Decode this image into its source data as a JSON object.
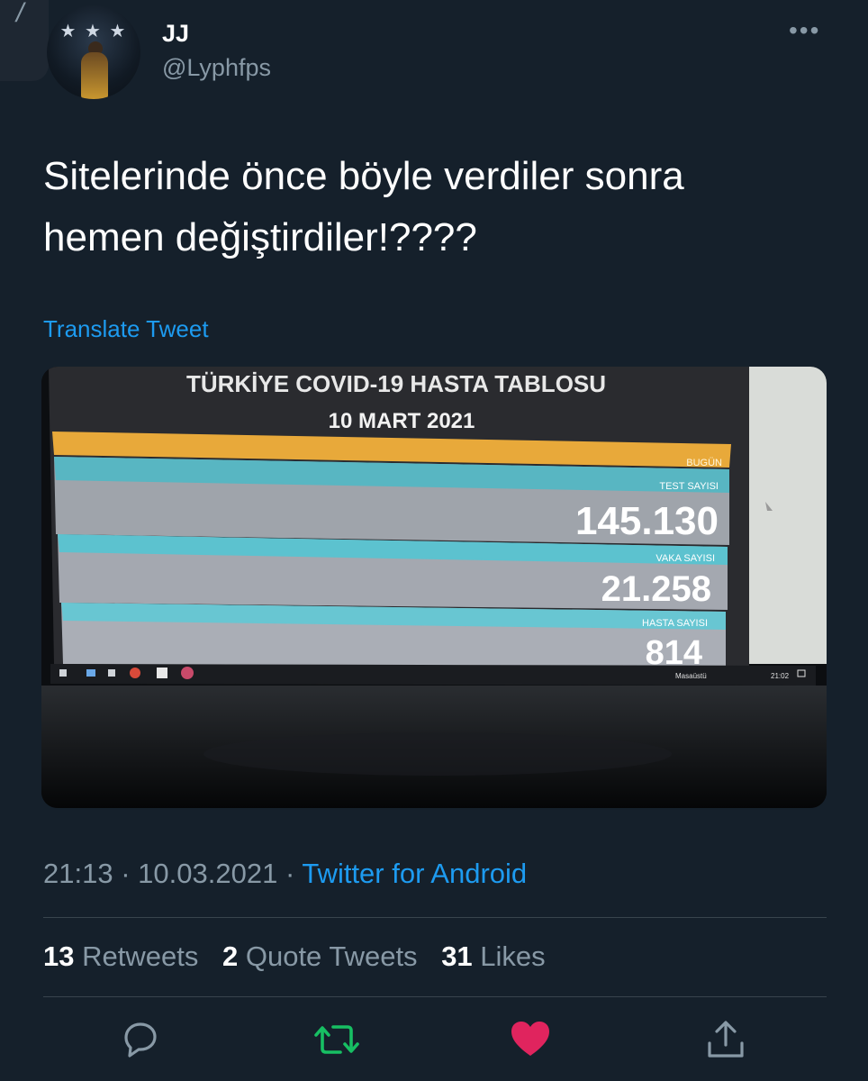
{
  "tweet": {
    "author_name": "JJ",
    "author_handle": "@Lyphfps",
    "text_line1": "Sitelerinde önce böyle verdiler sonra",
    "text_line2": "hemen değiştirdiler!????",
    "translate_label": "Translate Tweet",
    "time": "21:13",
    "separator": "·",
    "date": "10.03.2021",
    "source": "Twitter for Android"
  },
  "media": {
    "title": "TÜRKİYE COVID-19 HASTA TABLOSU",
    "date": "10 MART 2021",
    "header_label": "BUGÜN",
    "rows": [
      {
        "label": "TEST SAYISI",
        "value": "145.130"
      },
      {
        "label": "VAKA SAYISI",
        "value": "21.258"
      },
      {
        "label": "HASTA SAYISI",
        "value": "814"
      }
    ],
    "taskbar_text": "Masaüstü",
    "taskbar_time": "21:02"
  },
  "stats": {
    "retweets_count": "13",
    "retweets_label": "Retweets",
    "quotes_count": "2",
    "quotes_label": "Quote Tweets",
    "likes_count": "31",
    "likes_label": "Likes"
  },
  "colors": {
    "background": "#15202b",
    "link": "#1d9bf0",
    "muted": "#8899a6",
    "retweet_active": "#17bf63",
    "like_active": "#e0245e"
  },
  "icons": [
    "reply-icon",
    "retweet-icon",
    "like-icon",
    "share-icon",
    "more-icon"
  ]
}
